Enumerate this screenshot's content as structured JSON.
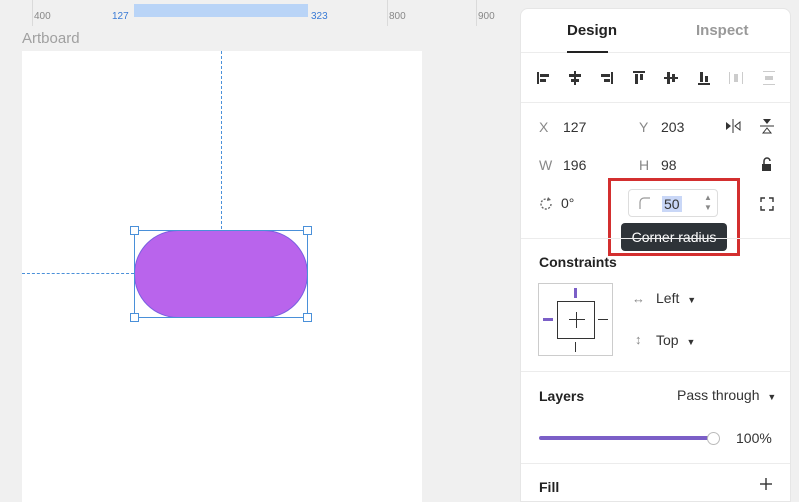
{
  "ruler": {
    "ticks": [
      "400",
      "127",
      "323",
      "800",
      "900"
    ]
  },
  "canvas": {
    "artboard_label": "Artboard"
  },
  "panel": {
    "tabs": {
      "design": "Design",
      "inspect": "Inspect"
    },
    "position": {
      "x_label": "X",
      "x_value": "127",
      "y_label": "Y",
      "y_value": "203"
    },
    "size": {
      "w_label": "W",
      "w_value": "196",
      "h_label": "H",
      "h_value": "98"
    },
    "rotation": "0°",
    "corner_radius": {
      "value": "50",
      "tooltip": "Corner radius"
    },
    "constraints": {
      "title": "Constraints",
      "horizontal": "Left",
      "vertical": "Top"
    },
    "layers": {
      "title": "Layers",
      "blend": "Pass through",
      "opacity": "100%",
      "opacity_level": 1.0
    },
    "fill": {
      "title": "Fill"
    }
  },
  "colors": {
    "shape_fill": "#b964ec",
    "selection": "#4a90d9",
    "accent": "#7b5fc7",
    "highlight": "#d32f2f"
  }
}
